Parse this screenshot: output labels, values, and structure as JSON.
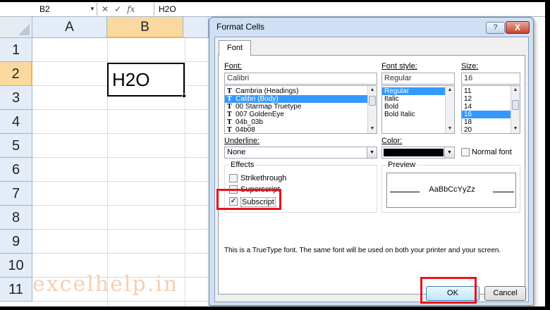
{
  "formula_bar": {
    "name_box": "B2",
    "cancel_icon": "✕",
    "enter_icon": "✓",
    "function_icon": "fx",
    "content": "H2O"
  },
  "sheet": {
    "columns": [
      "A",
      "B"
    ],
    "selected_column": "B",
    "rows": [
      "1",
      "2",
      "3",
      "4",
      "5",
      "6",
      "7",
      "8",
      "9",
      "10",
      "11"
    ],
    "selected_row": "2",
    "cell_b2": "H2O",
    "watermark": "excelhelp.in"
  },
  "dialog": {
    "title": "Format Cells",
    "help_label": "?",
    "close_label": "X",
    "tab_label": "Font",
    "font_label": "Font:",
    "font_value": "Calibri",
    "font_list": [
      {
        "name": "Cambria (Headings)",
        "selected": false
      },
      {
        "name": "Calibri (Body)",
        "selected": true
      },
      {
        "name": "00 Starmap Truetype",
        "selected": false
      },
      {
        "name": "007 GoldenEye",
        "selected": false
      },
      {
        "name": "04b_03b",
        "selected": false
      },
      {
        "name": "04b08",
        "selected": false
      }
    ],
    "font_style_label": "Font style:",
    "font_style_value": "Regular",
    "font_style_list": [
      "Regular",
      "Italic",
      "Bold",
      "Bold Italic"
    ],
    "size_label": "Size:",
    "size_value": "16",
    "size_list": [
      "11",
      "12",
      "14",
      "16",
      "18",
      "20"
    ],
    "size_selected": "16",
    "underline_label": "Underline:",
    "underline_value": "None",
    "color_label": "Color:",
    "color_swatch": "#000000",
    "normal_font_label": "Normal font",
    "effects_label": "Effects",
    "strikethrough_label": "Strikethrough",
    "superscript_label": "Superscript",
    "subscript_label": "Subscript",
    "subscript_checked": true,
    "preview_label": "Preview",
    "preview_text": "AaBbCcYyZz",
    "info_text": "This is a TrueType font.  The same font will be used on both your printer and your screen.",
    "ok_label": "OK",
    "cancel_label": "Cancel",
    "highlight_color": "#e8141c",
    "selection_color": "#3399ff"
  }
}
